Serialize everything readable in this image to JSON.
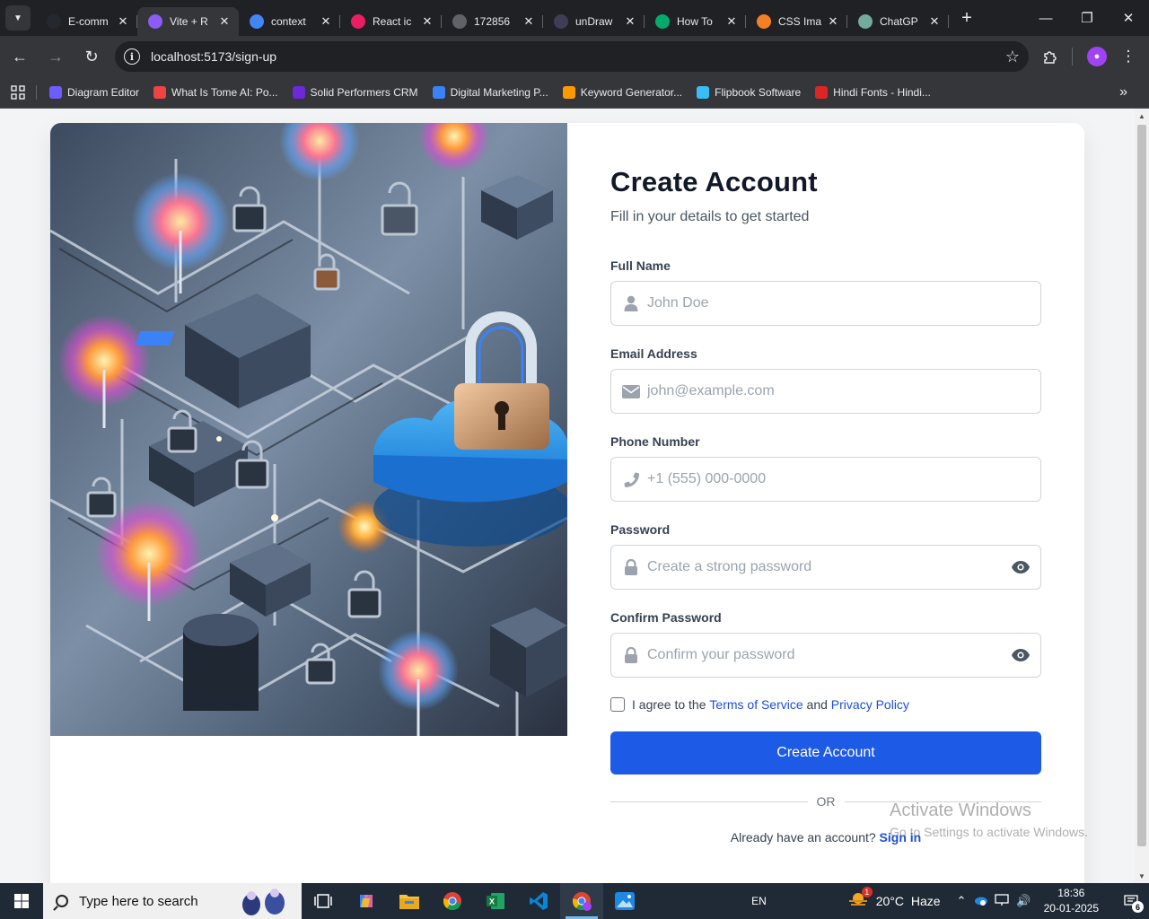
{
  "browser": {
    "tabs": [
      {
        "title": "E-comm",
        "icon": "github-icon",
        "color": "#24292f"
      },
      {
        "title": "Vite + R",
        "icon": "vite-icon",
        "color": "#8b5cf6",
        "active": true
      },
      {
        "title": "context",
        "icon": "google-icon",
        "color": "#4285f4"
      },
      {
        "title": "React ic",
        "icon": "react-icons-icon",
        "color": "#e91e63"
      },
      {
        "title": "172856",
        "icon": "globe-icon",
        "color": "#5f6368"
      },
      {
        "title": "unDraw",
        "icon": "undraw-icon",
        "color": "#3f3d56"
      },
      {
        "title": "How To",
        "icon": "w3schools-icon",
        "color": "#04aa6d"
      },
      {
        "title": "CSS Ima",
        "icon": "stackoverflow-icon",
        "color": "#f48024"
      },
      {
        "title": "ChatGP",
        "icon": "chatgpt-icon",
        "color": "#74aa9c"
      }
    ],
    "url": "localhost:5173/sign-up",
    "bookmarks": [
      {
        "label": "Diagram Editor",
        "icon": "diagram-editor-icon",
        "color": "#6d5dfc"
      },
      {
        "label": "What Is Tome AI: Po...",
        "icon": "tome-icon",
        "color": "#ef4444"
      },
      {
        "label": "Solid Performers CRM",
        "icon": "crm-icon",
        "color": "#6d28d9"
      },
      {
        "label": "Digital Marketing P...",
        "icon": "marketing-icon",
        "color": "#3b82f6"
      },
      {
        "label": "Keyword Generator...",
        "icon": "amazon-icon",
        "color": "#ff9900"
      },
      {
        "label": "Flipbook Software",
        "icon": "flipbook-icon",
        "color": "#38bdf8"
      },
      {
        "label": "Hindi Fonts - Hindi...",
        "icon": "hindi-fonts-icon",
        "color": "#dc2626"
      }
    ]
  },
  "signup": {
    "title": "Create Account",
    "subtitle": "Fill in your details to get started",
    "fields": [
      {
        "label": "Full Name",
        "placeholder": "John Doe",
        "icon": "user-icon",
        "type": "text"
      },
      {
        "label": "Email Address",
        "placeholder": "john@example.com",
        "icon": "envelope-icon",
        "type": "email"
      },
      {
        "label": "Phone Number",
        "placeholder": "+1 (555) 000-0000",
        "icon": "phone-icon",
        "type": "tel"
      },
      {
        "label": "Password",
        "placeholder": "Create a strong password",
        "icon": "lock-icon",
        "type": "password"
      },
      {
        "label": "Confirm Password",
        "placeholder": "Confirm your password",
        "icon": "lock-icon",
        "type": "password"
      }
    ],
    "agree_prefix": "I agree to the",
    "terms_link": "Terms of Service",
    "agree_and": "and",
    "privacy_link": "Privacy Policy",
    "submit_label": "Create Account",
    "divider_text": "OR",
    "signin_prompt": "Already have an account?",
    "signin_link": "Sign in",
    "accent_color": "#1d5ae6"
  },
  "watermark": {
    "line1": "Activate Windows",
    "line2": "Go to Settings to activate Windows."
  },
  "taskbar": {
    "search_placeholder": "Type here to search",
    "language": "EN",
    "weather_badge": "1",
    "temperature": "20°C",
    "weather": "Haze",
    "time": "18:36",
    "date": "20-01-2025",
    "notification_count": "6"
  }
}
